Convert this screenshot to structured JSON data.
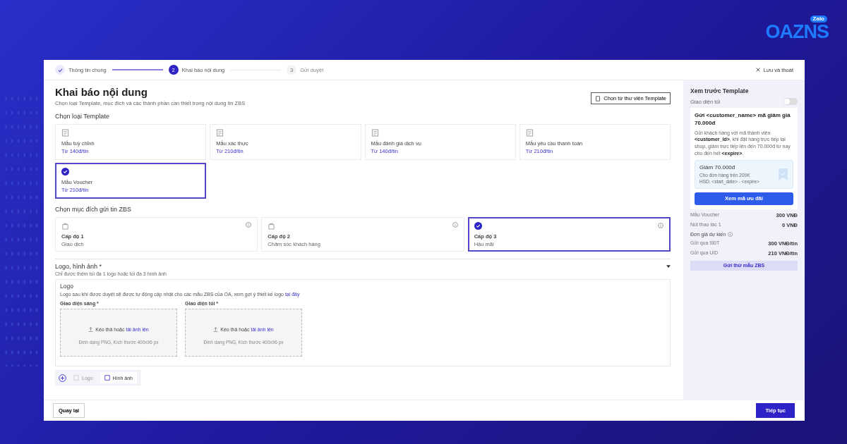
{
  "brand": {
    "name": "OAZNS",
    "badge": "Zalo"
  },
  "stepper": [
    {
      "label": "Thông tin chung",
      "done": true,
      "selected": false
    },
    {
      "number": "2",
      "label": "Khai báo nội dung",
      "done": false,
      "selected": true
    },
    {
      "number": "3",
      "label": "Gửi duyệt",
      "done": false,
      "selected": false
    }
  ],
  "save_exit": "Lưu và thoát",
  "page": {
    "title": "Khai báo nội dung",
    "subtitle": "Chọn loại Template, mục đích và các thành phần cần thiết trong nội dung tin ZBS",
    "library_button": "Chọn từ thư viện Template"
  },
  "template_section": {
    "title": "Chọn loại Template",
    "options": [
      {
        "name": "Mẫu tuỳ chỉnh",
        "price": "Từ 140đ/tin",
        "selected": false
      },
      {
        "name": "Mẫu xác thực",
        "price": "Từ 210đ/tin",
        "selected": false
      },
      {
        "name": "Mẫu đánh giá dịch vụ",
        "price": "Từ 140đ/tin",
        "selected": false
      },
      {
        "name": "Mẫu yêu cầu thanh toán",
        "price": "Từ 210đ/tin",
        "selected": false
      },
      {
        "name": "Mẫu Voucher",
        "price": "Từ 210đ/tin",
        "selected": true
      }
    ]
  },
  "purpose_section": {
    "title": "Chọn mục đích gửi tin ZBS",
    "options": [
      {
        "level": "Cấp độ 1",
        "description": "Giao dịch",
        "selected": false
      },
      {
        "level": "Cấp độ 2",
        "description": "Chăm sóc khách hàng",
        "selected": false
      },
      {
        "level": "Cấp độ 3",
        "description": "Hậu mãi",
        "selected": true
      }
    ]
  },
  "logo_section": {
    "title": "Logo, hình ảnh *",
    "note": "Chỉ được thêm tối đa 1 logo hoặc tối đa 3 hình ảnh",
    "box_title": "Logo",
    "box_note": "Logo sau khi được duyệt sẽ được tự động cập nhật cho các mẫu ZBS của OA, xem gợi ý thiết kế logo",
    "box_link": "tại đây",
    "uploads": [
      {
        "label": "Giao diện sáng *",
        "prompt": "Kéo thả hoặc",
        "link": "tải ảnh lên",
        "hint": "Định dạng PNG, Kích thước 400x96 px"
      },
      {
        "label": "Giao diện tối *",
        "prompt": "Kéo thả hoặc",
        "link": "tải ảnh lên",
        "hint": "Định dạng PNG, Kích thước 400x96 px"
      }
    ],
    "add_items": [
      {
        "label": "Logo",
        "disabled": true
      },
      {
        "label": "Hình ảnh",
        "disabled": false
      }
    ]
  },
  "footer": {
    "back": "Quay lại",
    "next": "Tiếp tục"
  },
  "preview": {
    "title": "Xem trước Template",
    "dark_mode_label": "Giao diện tối",
    "dark_mode": false,
    "message_title": "Gửi <customer_name> mã giảm giá 70.000đ",
    "message_body": "Gửi khách hàng với mã thành viên **<customer_id>**, khi đặt hàng trực tiếp tại shop, giảm trực tiếp lên đến 70.000đ từ nay cho đến hết **<expire>**.",
    "voucher": {
      "title": "Giảm 70.000đ",
      "condition": "Cho đơn hàng trên 200K",
      "expiry": "HSD: <start_date> - <expire>"
    },
    "cta": "Xem mã ưu đãi",
    "costs": [
      {
        "label": "Mẫu Voucher",
        "value": "300 VNĐ"
      },
      {
        "label": "Nút thao tác 1",
        "value": "0 VNĐ"
      }
    ],
    "unit_price_title": "Đơn giá dự kiến",
    "unit_prices": [
      {
        "label": "Gửi qua SĐT",
        "value": "300 VNĐ/tin"
      },
      {
        "label": "Gửi qua UID",
        "value": "210 VNĐ/tin"
      }
    ],
    "test_button": "Gửi thử mẫu ZBS"
  }
}
